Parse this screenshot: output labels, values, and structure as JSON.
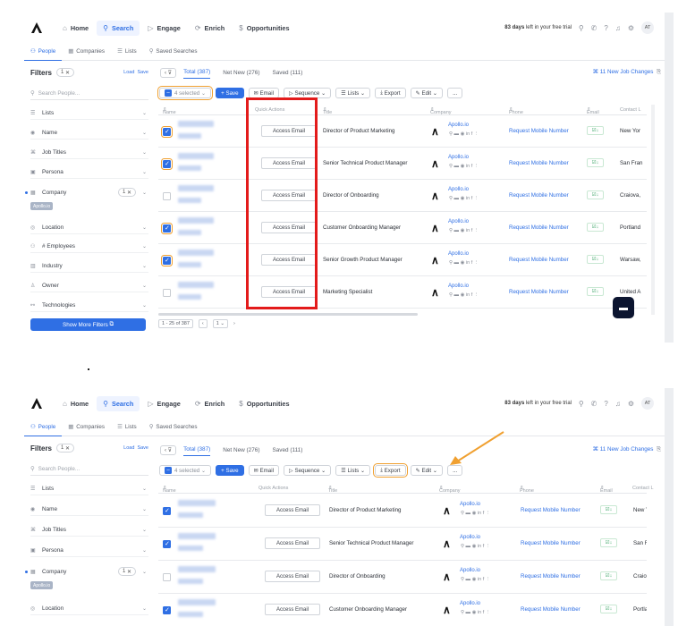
{
  "nav": {
    "items": [
      {
        "icon": "home-icon",
        "label": "Home"
      },
      {
        "icon": "search-icon",
        "label": "Search"
      },
      {
        "icon": "engage-icon",
        "label": "Engage"
      },
      {
        "icon": "enrich-icon",
        "label": "Enrich"
      },
      {
        "icon": "dollar-icon",
        "label": "Opportunities"
      }
    ],
    "trial_days": "83 days",
    "trial_rest": "left in your free trial",
    "avatar": "AT"
  },
  "subnav": {
    "items": [
      "People",
      "Companies",
      "Lists",
      "Saved Searches"
    ]
  },
  "filters": {
    "title": "Filters",
    "count": "1",
    "load": "Load",
    "save": "Save",
    "search_placeholder": "Search People...",
    "rows": [
      "Lists",
      "Name",
      "Job Titles",
      "Persona",
      "Company",
      "Location",
      "# Employees",
      "Industry",
      "Owner",
      "Technologies"
    ],
    "company_count": "1",
    "company_tag": "Apollo.io",
    "show_more": "Show More Filters"
  },
  "tabs": {
    "total": "Total (387)",
    "net_new": "Net New (276)",
    "saved": "Saved (111)",
    "job_changes": "11 New Job Changes"
  },
  "tabs_b": {
    "net_new": "Net New (276)"
  },
  "toolbar": {
    "selected": "4 selected",
    "save": "+ Save",
    "email": "Email",
    "sequence": "Sequence",
    "lists": "Lists",
    "export": "Export",
    "edit": "Edit",
    "more": "..."
  },
  "columns": {
    "name": "Name",
    "quick_actions": "Quick Actions",
    "title": "Title",
    "company": "Company",
    "phone": "Phone",
    "email": "Email",
    "contact": "Contact L"
  },
  "rows": [
    {
      "checked": true,
      "action": "Access Email",
      "title": "Director of Product Marketing",
      "company": "Apollo.io",
      "phone": "Request Mobile Number",
      "contact": "New Yor"
    },
    {
      "checked": true,
      "action": "Access Email",
      "title": "Senior Technical Product Manager",
      "company": "Apollo.io",
      "phone": "Request Mobile Number",
      "contact": "San Fran"
    },
    {
      "checked": false,
      "action": "Access Email",
      "title": "Director of Onboarding",
      "company": "Apollo.io",
      "phone": "Request Mobile Number",
      "contact": "Craiova,"
    },
    {
      "checked": true,
      "action": "Access Email",
      "title": "Customer Onboarding Manager",
      "company": "Apollo.io",
      "phone": "Request Mobile Number",
      "contact": "Portland"
    },
    {
      "checked": true,
      "action": "Access Email",
      "title": "Senior Growth Product Manager",
      "company": "Apollo.io",
      "phone": "Request Mobile Number",
      "contact": "Warsaw,"
    },
    {
      "checked": false,
      "action": "Access Email",
      "title": "Marketing Specialist",
      "company": "Apollo.io",
      "phone": "Request Mobile Number",
      "contact": "United A"
    }
  ],
  "pager": {
    "range": "1 - 25 of 387",
    "page": "1"
  },
  "accent": "#2f6fe4",
  "highlight_colors": {
    "red_box": "#e31b1b",
    "orange": "#f0a030"
  }
}
